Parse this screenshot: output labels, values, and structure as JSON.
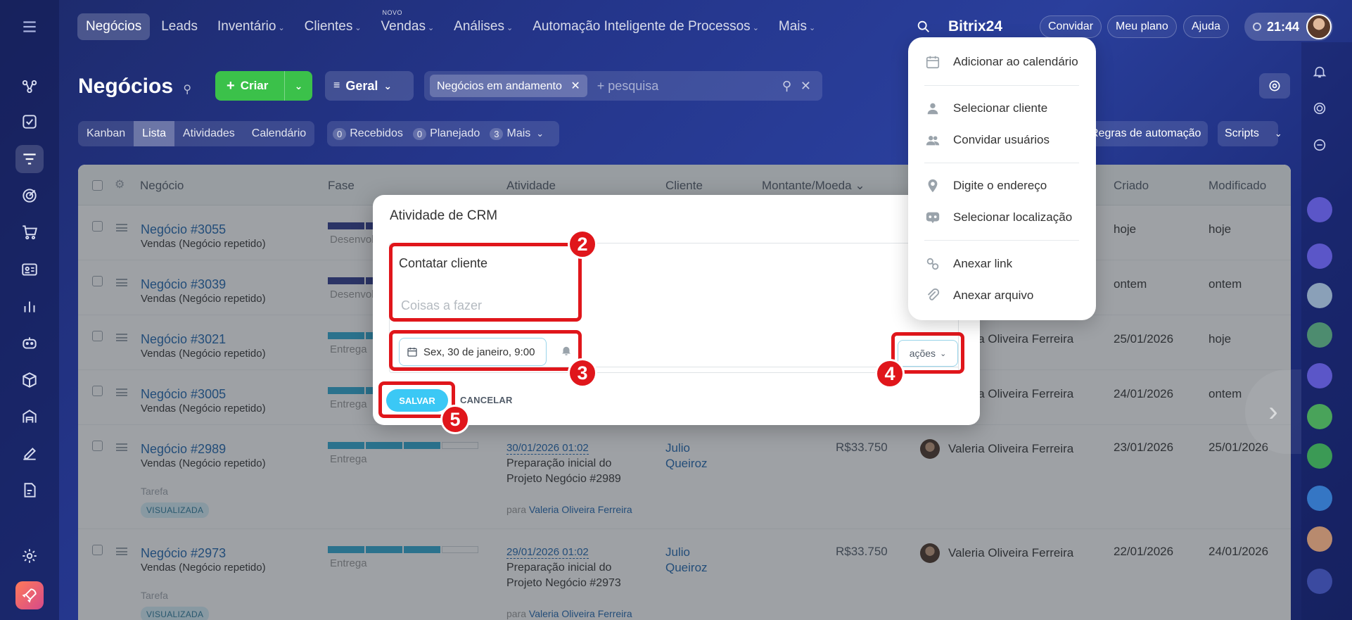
{
  "topnav": {
    "items": [
      {
        "label": "Negócios",
        "caret": false,
        "active": true
      },
      {
        "label": "Leads",
        "caret": false
      },
      {
        "label": "Inventário",
        "caret": true
      },
      {
        "label": "Clientes",
        "caret": true
      },
      {
        "label": "Vendas",
        "caret": true,
        "badge": "NOVO"
      },
      {
        "label": "Análises",
        "caret": true
      },
      {
        "label": "Automação Inteligente de Processos",
        "caret": true
      },
      {
        "label": "Mais",
        "caret": true
      }
    ],
    "brand": "Bitrix24",
    "invite": "Convidar",
    "my_plan": "Meu plano",
    "help": "Ajuda",
    "time": "21:44"
  },
  "header": {
    "title": "Negócios",
    "create_label": "Criar",
    "general_label": "Geral",
    "filter_chip": "Negócios em andamento",
    "search_placeholder": "+ pesquisa"
  },
  "view_tabs": [
    "Kanban",
    "Lista",
    "Atividades",
    "Calendário"
  ],
  "counters": [
    {
      "count": "0",
      "label": "Recebidos"
    },
    {
      "count": "0",
      "label": "Planejado"
    },
    {
      "count": "3",
      "label": "Mais"
    }
  ],
  "toolbar_right": {
    "automation_rules": "Regras de automação",
    "scripts": "Scripts"
  },
  "table": {
    "headers": {
      "deal": "Negócio",
      "phase": "Fase",
      "activity": "Atividade",
      "client": "Cliente",
      "amount": "Montante/Moeda",
      "created": "Criado",
      "modified": "Modificado"
    },
    "rows": [
      {
        "name": "Negócio #3055",
        "sub": "Vendas (Negócio repetido)",
        "phase": "Desenvol",
        "created": "hoje",
        "modified": "hoje"
      },
      {
        "name": "Negócio #3039",
        "sub": "Vendas (Negócio repetido)",
        "phase": "Desenvol",
        "created": "ontem",
        "modified": "ontem"
      },
      {
        "name": "Negócio #3021",
        "sub": "Vendas (Negócio repetido)",
        "phase": "Entrega",
        "responsible": "Valeria Oliveira Ferreira",
        "created": "25/01/2026",
        "modified": "hoje"
      },
      {
        "name": "Negócio #3005",
        "sub": "Vendas (Negócio repetido)",
        "phase": "Entrega",
        "responsible": "Valeria Oliveira Ferreira",
        "created": "24/01/2026",
        "modified": "ontem"
      },
      {
        "name": "Negócio #2989",
        "sub": "Vendas (Negócio repetido)",
        "phase": "Entrega",
        "activity_date": "30/01/2026 01:02",
        "activity_text": "Preparação inicial do Projeto Negócio #2989",
        "activity_for": "para",
        "activity_for_name": "Valeria Oliveira Ferreira",
        "client": "Julio Queiroz",
        "amount": "R$33.750",
        "responsible": "Valeria Oliveira Ferreira",
        "created": "23/01/2026",
        "modified": "25/01/2026",
        "tarefa": "Tarefa",
        "badge": "VISUALIZADA"
      },
      {
        "name": "Negócio #2973",
        "sub": "Vendas (Negócio repetido)",
        "phase": "Entrega",
        "activity_date": "29/01/2026 01:02",
        "activity_text": "Preparação inicial do Projeto Negócio #2973",
        "activity_for": "para",
        "activity_for_name": "Valeria Oliveira Ferreira",
        "client": "Julio Queiroz",
        "amount": "R$33.750",
        "responsible": "Valeria Oliveira Ferreira",
        "created": "22/01/2026",
        "modified": "24/01/2026",
        "tarefa": "Tarefa",
        "badge": "VISUALIZADA"
      }
    ]
  },
  "modal": {
    "title": "Atividade de CRM",
    "task_title": "Contatar cliente",
    "task_placeholder": "Coisas a fazer",
    "date": "Sex, 30 de janeiro, 9:00",
    "actions": "ações",
    "save": "SALVAR",
    "cancel": "CANCELAR"
  },
  "callouts": [
    "2",
    "3",
    "4",
    "5"
  ],
  "popup_menu": [
    {
      "label": "Adicionar ao calendário",
      "icon": "calendar-icon"
    },
    {
      "label": "Selecionar cliente",
      "icon": "user-icon"
    },
    {
      "label": "Convidar usuários",
      "icon": "users-icon"
    },
    {
      "label": "Digite o endereço",
      "icon": "map-pin-icon"
    },
    {
      "label": "Selecionar localização",
      "icon": "location-icon"
    },
    {
      "label": "Anexar link",
      "icon": "link-icon"
    },
    {
      "label": "Anexar arquivo",
      "icon": "paperclip-icon"
    }
  ],
  "colors": {
    "accent_green": "#3bc14a",
    "save_blue": "#3bc8f5",
    "callout_red": "#e0161b",
    "link_blue": "#2067b0"
  }
}
